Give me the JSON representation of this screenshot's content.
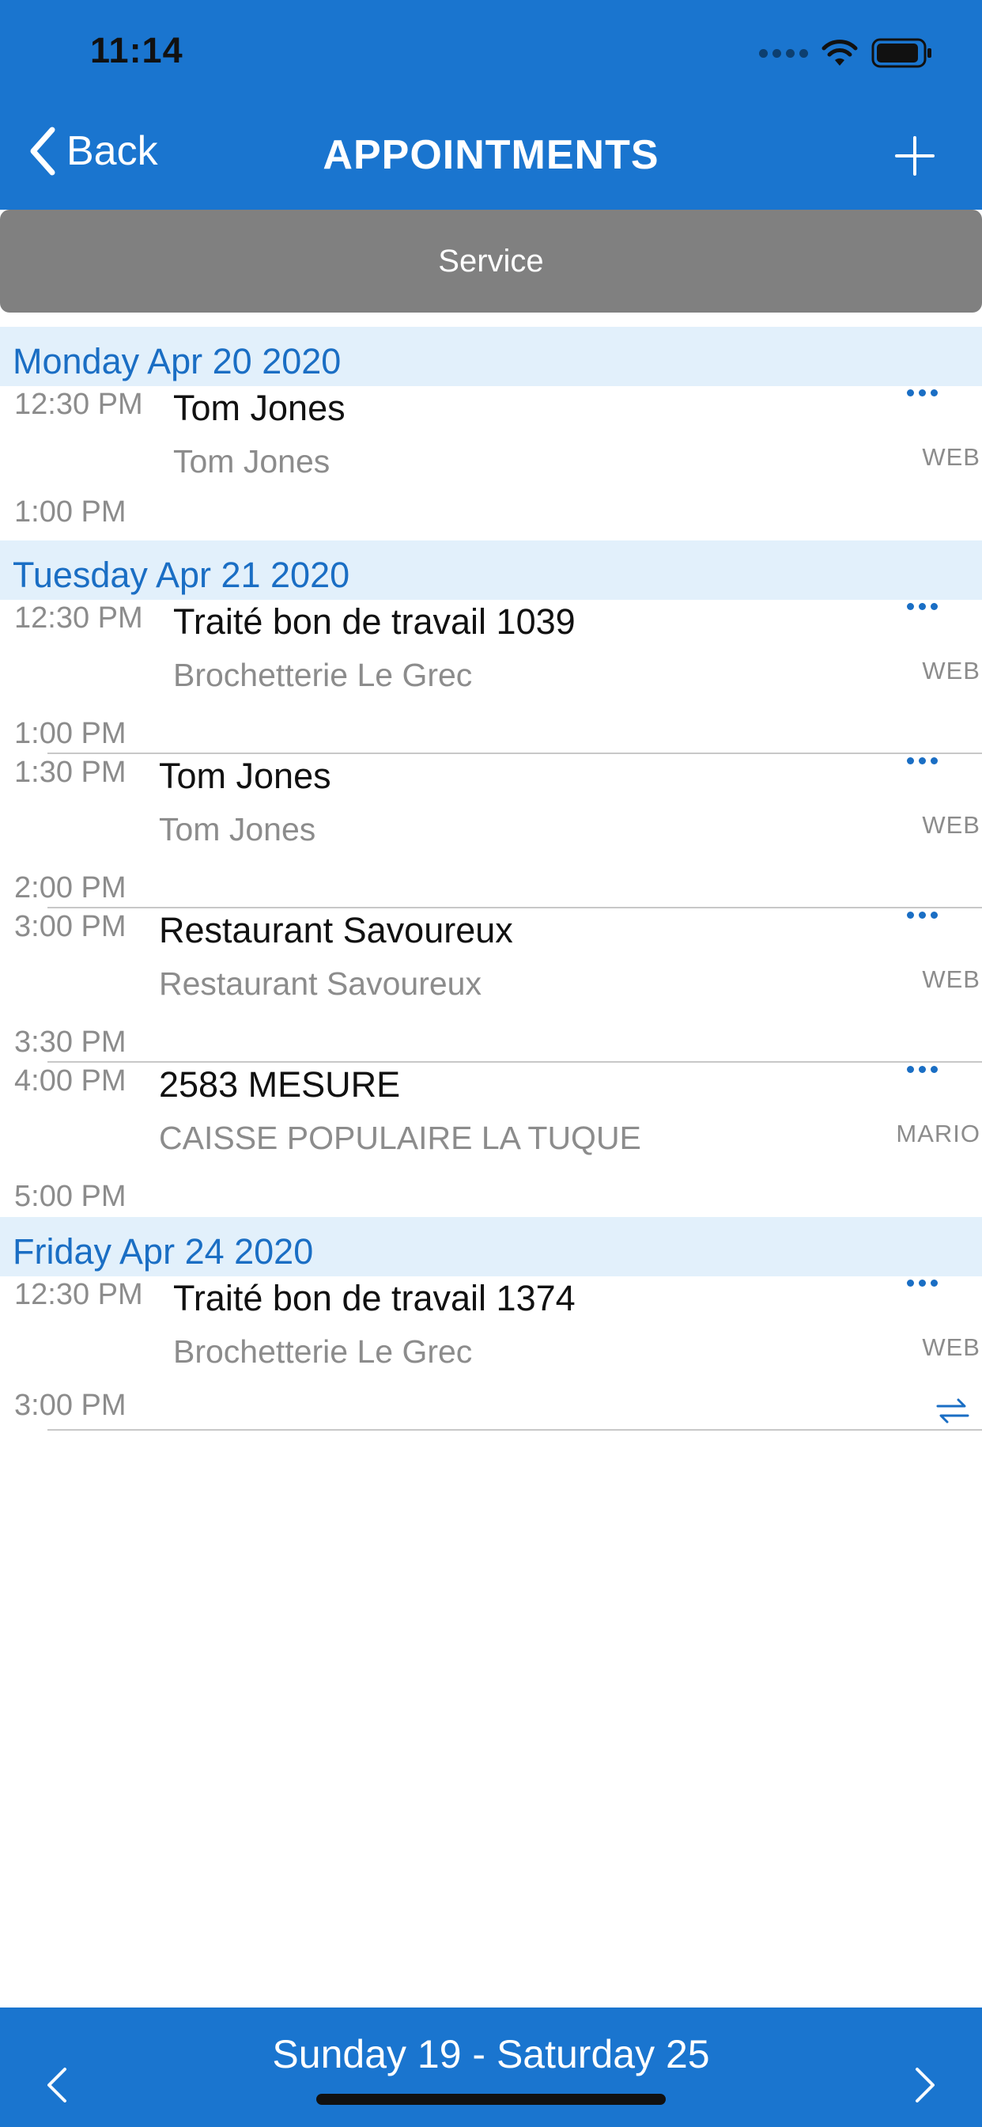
{
  "status_bar": {
    "time": "11:14"
  },
  "nav": {
    "back_label": "Back",
    "title": "APPOINTMENTS"
  },
  "filter": {
    "label": "Service"
  },
  "days": [
    {
      "date_label": "Monday Apr 20 2020",
      "appointments": [
        {
          "start": "12:30 PM",
          "end": "1:00 PM",
          "title": "Tom Jones",
          "subtitle": "Tom Jones",
          "source": "WEB"
        }
      ]
    },
    {
      "date_label": "Tuesday Apr 21 2020",
      "appointments": [
        {
          "start": "12:30 PM",
          "end": "1:00 PM",
          "title": "Traité bon de travail 1039",
          "subtitle": "Brochetterie Le Grec",
          "source": "WEB"
        },
        {
          "start": "1:30 PM",
          "end": "2:00 PM",
          "title": "Tom Jones",
          "subtitle": "Tom Jones",
          "source": "WEB"
        },
        {
          "start": "3:00 PM",
          "end": "3:30 PM",
          "title": "Restaurant Savoureux",
          "subtitle": "Restaurant Savoureux",
          "source": "WEB"
        },
        {
          "start": "4:00 PM",
          "end": "5:00 PM",
          "title": "2583 MESURE",
          "subtitle": "CAISSE POPULAIRE LA TUQUE",
          "source": "MARIO"
        }
      ]
    },
    {
      "date_label": "Friday Apr 24 2020",
      "appointments": [
        {
          "start": "12:30 PM",
          "end": "3:00 PM",
          "title": "Traité bon de travail 1374",
          "subtitle": "Brochetterie Le Grec",
          "source": "WEB"
        }
      ]
    }
  ],
  "footer": {
    "week_range": "Sunday 19 - Saturday 25"
  },
  "colors": {
    "accent": "#1a75cf",
    "day_header_bg": "#e2f0fb",
    "day_header_text": "#1a6ec4",
    "filter_bg": "#808080"
  },
  "icons": [
    "signal-icon",
    "wifi-icon",
    "battery-icon",
    "chevron-left-icon",
    "plus-icon",
    "more-icon",
    "sync-icon",
    "chevron-right-icon"
  ]
}
